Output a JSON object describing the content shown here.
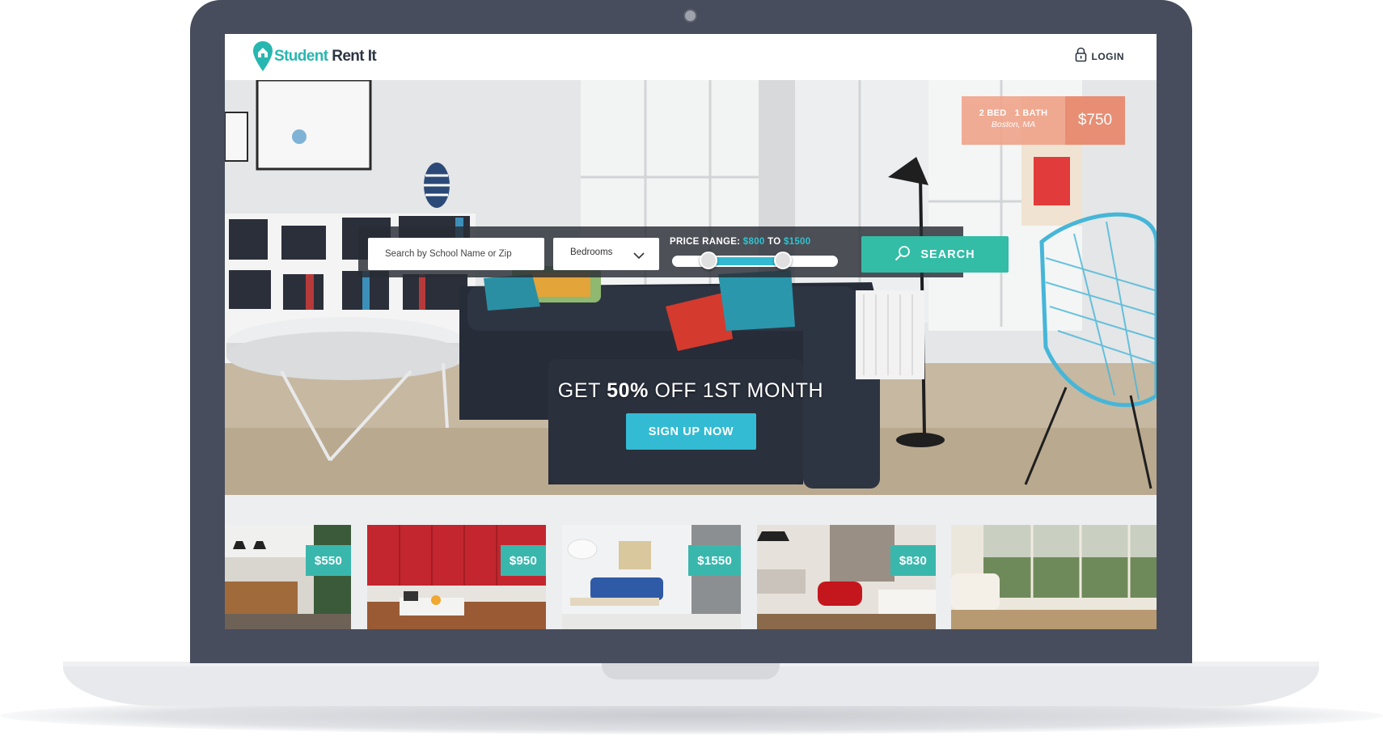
{
  "brand": {
    "part1": "Student ",
    "part2": "Rent It"
  },
  "header": {
    "login_label": "LOGIN"
  },
  "featured": {
    "specs": "2 BED   1 BATH",
    "location": "Boston, MA",
    "price": "$750"
  },
  "search": {
    "placeholder": "Search by School Name or Zip",
    "bedrooms_label": "Bedrooms",
    "price_prefix": "PRICE RANGE: ",
    "price_min": "$800",
    "price_sep": " TO ",
    "price_max": "$1500",
    "range_min_fraction": 0.22,
    "range_max_fraction": 0.67,
    "button_label": "SEARCH"
  },
  "promo": {
    "prefix": "GET ",
    "highlight": "50%",
    "suffix": " OFF 1ST MONTH",
    "button_label": "SIGN UP NOW"
  },
  "listings": [
    {
      "price": "$550"
    },
    {
      "price": "$950"
    },
    {
      "price": "$1550"
    },
    {
      "price": "$830"
    },
    {
      "price": ""
    }
  ],
  "colors": {
    "teal": "#33bca6",
    "cyan": "#33bbd3",
    "salmon": "#e8876b",
    "frame": "#474d5c",
    "navy": "#2d3542"
  },
  "icons": [
    "location-pin-icon",
    "lock-icon",
    "chevron-down-icon",
    "search-icon"
  ]
}
